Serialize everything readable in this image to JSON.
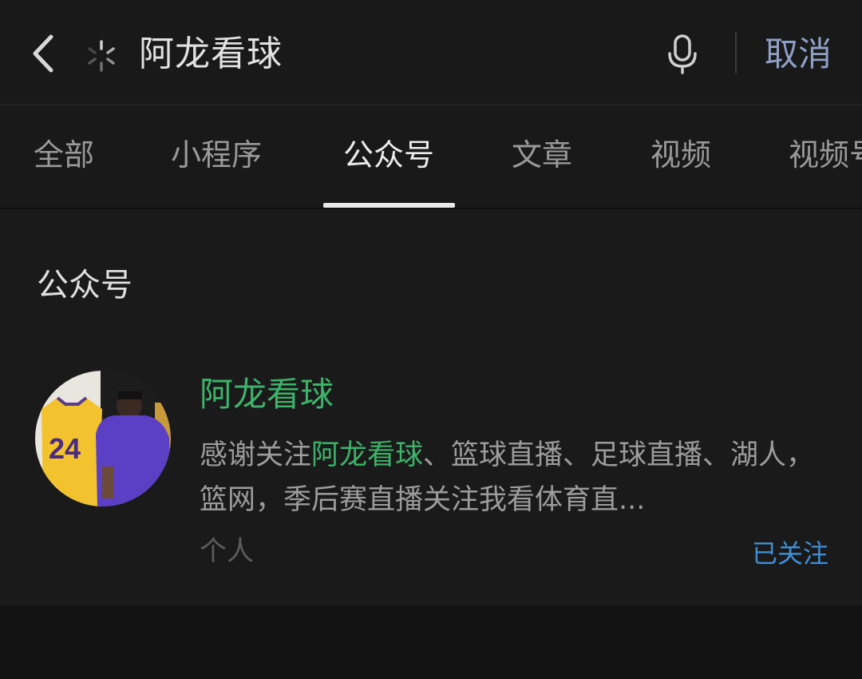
{
  "search": {
    "query": "阿龙看球",
    "cancel_label": "取消"
  },
  "tabs": [
    {
      "label": "全部"
    },
    {
      "label": "小程序"
    },
    {
      "label": "公众号"
    },
    {
      "label": "文章"
    },
    {
      "label": "视频"
    },
    {
      "label": "视频号"
    }
  ],
  "active_tab": "公众号",
  "section": {
    "title": "公众号",
    "account": {
      "name": "阿龙看球",
      "desc_prefix": "感谢关注",
      "desc_highlight": "阿龙看球",
      "desc_suffix": "、篮球直播、足球直播、湖人，篮网，季后赛直播关注我看体育直...",
      "type": "个人",
      "follow_status": "已关注"
    }
  },
  "colors": {
    "background": "#121212",
    "highlight_green": "#3db36a",
    "link_blue": "#3f8fd6",
    "cancel_blue": "#8ea0c6"
  },
  "icons": {
    "back": "chevron-left-icon",
    "loading": "loading-spinner-icon",
    "voice": "microphone-icon"
  }
}
